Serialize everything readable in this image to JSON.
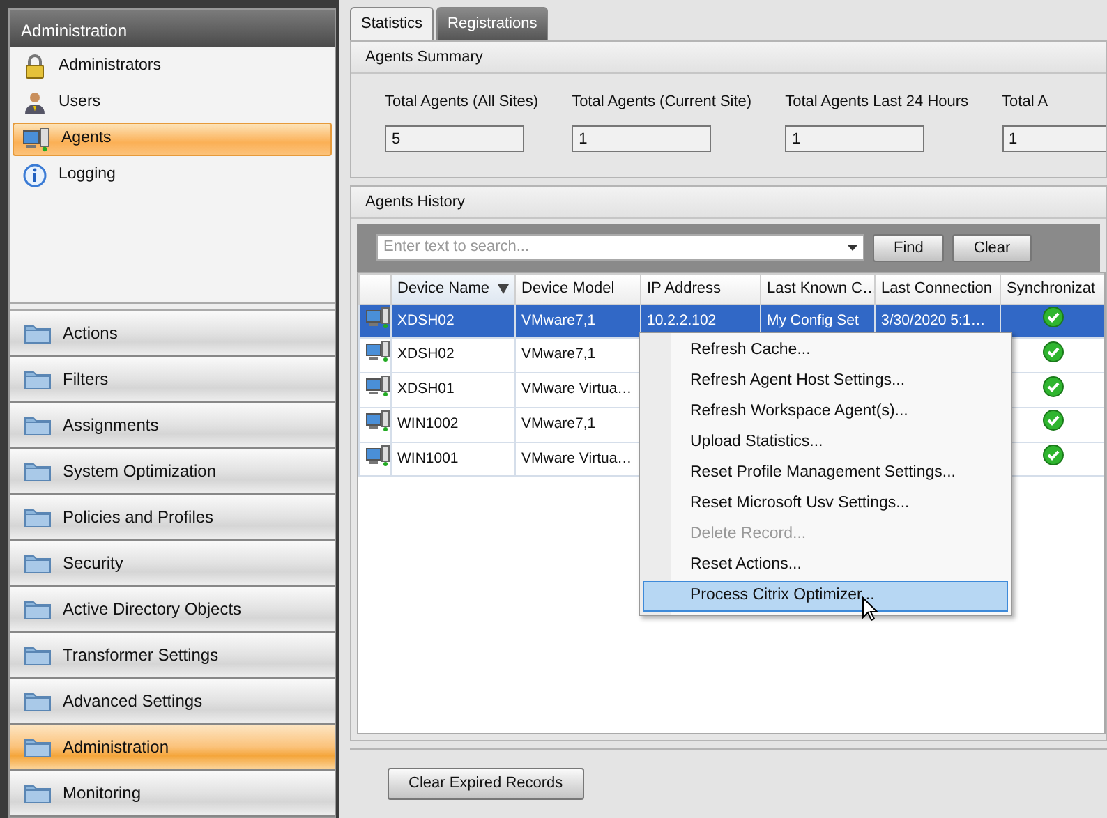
{
  "sidebar": {
    "title": "Administration",
    "items": [
      {
        "label": "Administrators",
        "selected": false
      },
      {
        "label": "Users",
        "selected": false
      },
      {
        "label": "Agents",
        "selected": true
      },
      {
        "label": "Logging",
        "selected": false
      }
    ],
    "sections": [
      {
        "label": "Actions",
        "selected": false
      },
      {
        "label": "Filters",
        "selected": false
      },
      {
        "label": "Assignments",
        "selected": false
      },
      {
        "label": "System Optimization",
        "selected": false
      },
      {
        "label": "Policies and Profiles",
        "selected": false
      },
      {
        "label": "Security",
        "selected": false
      },
      {
        "label": "Active Directory Objects",
        "selected": false
      },
      {
        "label": "Transformer Settings",
        "selected": false
      },
      {
        "label": "Advanced Settings",
        "selected": false
      },
      {
        "label": "Administration",
        "selected": true
      },
      {
        "label": "Monitoring",
        "selected": false
      }
    ]
  },
  "tabs": [
    {
      "label": "Statistics",
      "selected": true
    },
    {
      "label": "Registrations",
      "selected": false
    }
  ],
  "summary": {
    "title": "Agents Summary",
    "stats": [
      {
        "label": "Total Agents (All Sites)",
        "value": "5"
      },
      {
        "label": "Total Agents (Current Site)",
        "value": "1"
      },
      {
        "label": "Total Agents Last 24 Hours",
        "value": "1"
      },
      {
        "label": "Total A",
        "value": "1"
      }
    ]
  },
  "history": {
    "title": "Agents History",
    "search": {
      "placeholder": "Enter text to search..."
    },
    "buttons": [
      "Find",
      "Clear"
    ],
    "columns": [
      {
        "label": "Device Name",
        "sorted": true
      },
      {
        "label": "Device Model",
        "sorted": false
      },
      {
        "label": "IP Address",
        "sorted": false
      },
      {
        "label": "Last Known C…",
        "sorted": false
      },
      {
        "label": "Last Connection",
        "sorted": false
      },
      {
        "label": "Synchronizat",
        "sorted": false
      }
    ],
    "rows": [
      {
        "cells": [
          "XDSH02",
          "VMware7,1",
          "10.2.2.102",
          "My Config Set",
          "3/30/2020 5:1…"
        ],
        "selected": true,
        "synchronized": true
      },
      {
        "cells": [
          "XDSH02",
          "VMware7,1"
        ],
        "selected": false,
        "synchronized": true
      },
      {
        "cells": [
          "XDSH01",
          "VMware Virtua…"
        ],
        "selected": false,
        "synchronized": true
      },
      {
        "cells": [
          "WIN1002",
          "VMware7,1"
        ],
        "selected": false,
        "synchronized": true
      },
      {
        "cells": [
          "WIN1001",
          "VMware Virtua…"
        ],
        "selected": false,
        "synchronized": true
      }
    ]
  },
  "context_menu": [
    {
      "label": "Refresh Cache...",
      "disabled": false,
      "highlighted": false
    },
    {
      "label": "Refresh Agent Host Settings...",
      "disabled": false,
      "highlighted": false
    },
    {
      "label": "Refresh Workspace Agent(s)...",
      "disabled": false,
      "highlighted": false
    },
    {
      "label": "Upload Statistics...",
      "disabled": false,
      "highlighted": false
    },
    {
      "label": "Reset Profile Management Settings...",
      "disabled": false,
      "highlighted": false
    },
    {
      "label": "Reset Microsoft Usv Settings...",
      "disabled": false,
      "highlighted": false
    },
    {
      "label": "Delete Record...",
      "disabled": true,
      "highlighted": false
    },
    {
      "label": "Reset Actions...",
      "disabled": false,
      "highlighted": false
    },
    {
      "label": "Process Citrix Optimizer...",
      "disabled": false,
      "highlighted": true
    }
  ],
  "footer": {
    "button": "Clear Expired Records"
  }
}
